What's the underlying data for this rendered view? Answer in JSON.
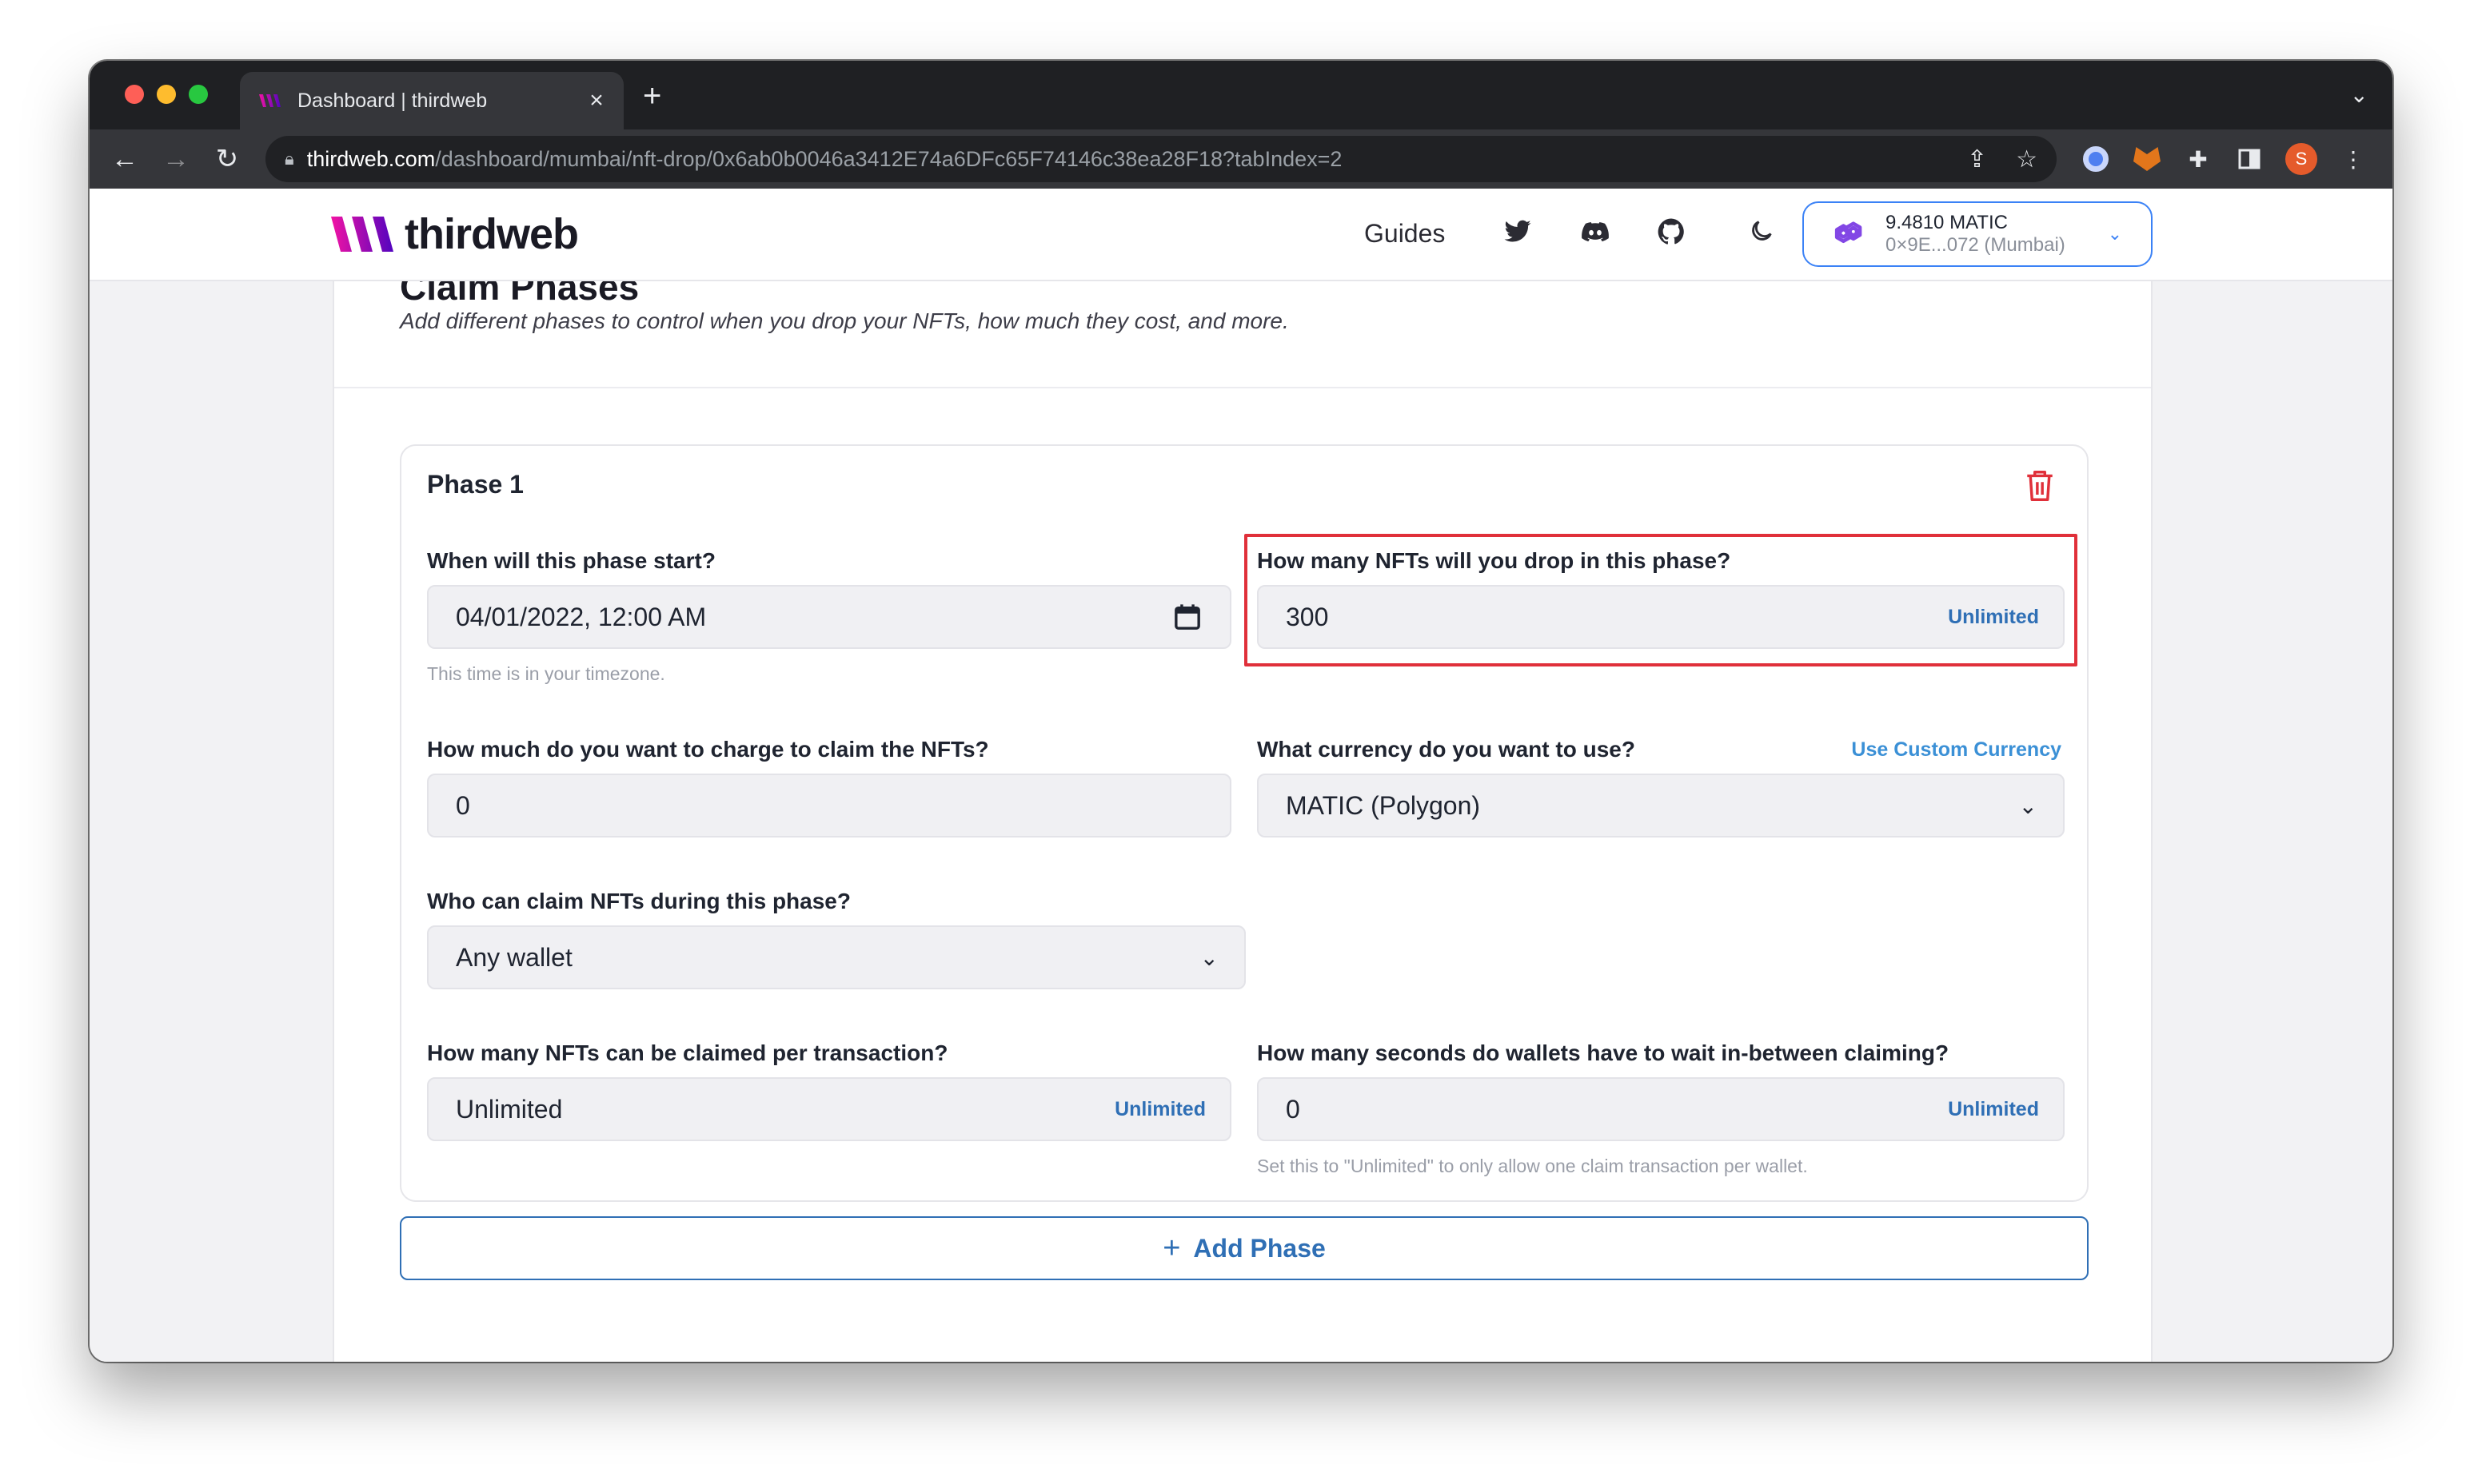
{
  "browser": {
    "tab_title": "Dashboard | thirdweb",
    "tab_close": "×",
    "new_tab": "+",
    "url_host": "thirdweb.com",
    "url_path": "/dashboard/mumbai/nft-drop/0x6ab0b0046a3412E74a6DFc65F74146c38ea28F18?tabIndex=2",
    "profile_initial": "S"
  },
  "header": {
    "logo_text": "thirdweb",
    "nav_guides": "Guides",
    "wallet_balance": "9.4810 MATIC",
    "wallet_address": "0×9E...072 (Mumbai)"
  },
  "section": {
    "title": "Claim Phases",
    "subtitle": "Add different phases to control when you drop your NFTs, how much they cost, and more."
  },
  "phase": {
    "title": "Phase 1",
    "start_label": "When will this phase start?",
    "start_value": "04/01/2022, 12:00 AM",
    "start_helper": "This time is in your timezone.",
    "quantity_label": "How many NFTs will you drop in this phase?",
    "quantity_value": "300",
    "quantity_unlimited": "Unlimited",
    "price_label": "How much do you want to charge to claim the NFTs?",
    "price_value": "0",
    "currency_label": "What currency do you want to use?",
    "currency_link": "Use Custom Currency",
    "currency_value": "MATIC (Polygon)",
    "who_label": "Who can claim NFTs during this phase?",
    "who_value": "Any wallet",
    "per_tx_label": "How many NFTs can be claimed per transaction?",
    "per_tx_value": "Unlimited",
    "per_tx_unlimited": "Unlimited",
    "wait_label": "How many seconds do wallets have to wait in-between claiming?",
    "wait_value": "0",
    "wait_unlimited": "Unlimited",
    "wait_helper": "Set this to \"Unlimited\" to only allow one claim transaction per wallet."
  },
  "add_phase": {
    "plus": "+",
    "label": "Add Phase"
  },
  "colors": {
    "accent": "#2f6fb5",
    "highlight": "#e0303a",
    "brand_gradient_start": "#f213a4",
    "brand_gradient_end": "#5204bf",
    "polygon": "#8247e5"
  }
}
